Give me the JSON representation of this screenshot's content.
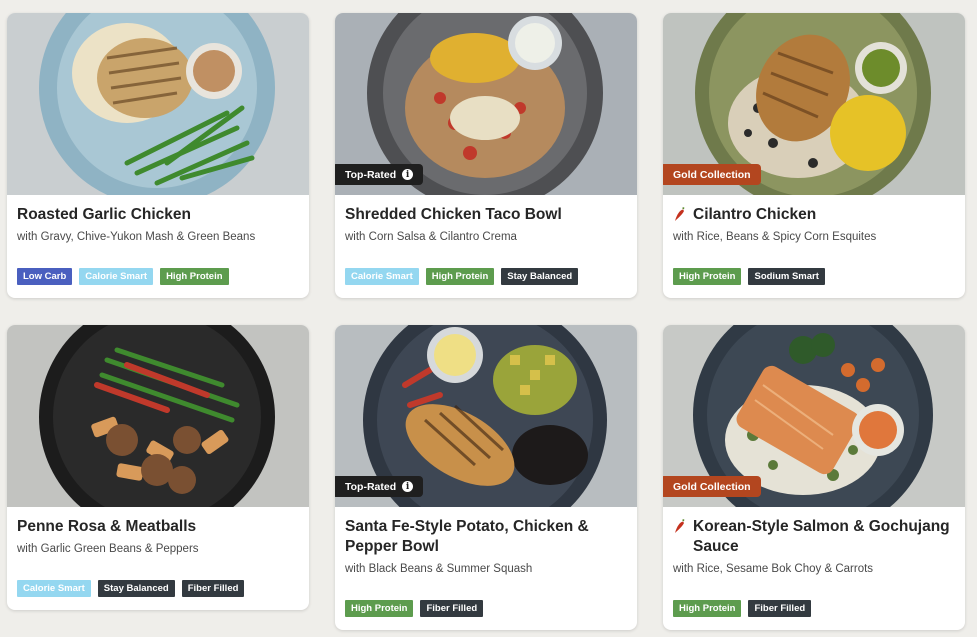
{
  "meals": [
    {
      "title": "Roasted Garlic Chicken",
      "subtitle": "with Gravy, Chive-Yukon Mash & Green Beans",
      "ribbon": null,
      "spicy": false,
      "tags": [
        "Low Carb",
        "Calorie Smart",
        "High Protein"
      ]
    },
    {
      "title": "Shredded Chicken Taco Bowl",
      "subtitle": "with Corn Salsa & Cilantro Crema",
      "ribbon": "Top-Rated",
      "spicy": false,
      "tags": [
        "Calorie Smart",
        "High Protein",
        "Stay Balanced"
      ]
    },
    {
      "title": "Cilantro Chicken",
      "subtitle": "with Rice, Beans & Spicy Corn Esquites",
      "ribbon": "Gold Collection",
      "spicy": true,
      "tags": [
        "High Protein",
        "Sodium Smart"
      ]
    },
    {
      "title": "Penne Rosa & Meatballs",
      "subtitle": "with Garlic Green Beans & Peppers",
      "ribbon": null,
      "spicy": false,
      "tags": [
        "Calorie Smart",
        "Stay Balanced",
        "Fiber Filled"
      ]
    },
    {
      "title": "Santa Fe-Style Potato, Chicken & Pepper Bowl",
      "subtitle": "with Black Beans & Summer Squash",
      "ribbon": "Top-Rated",
      "spicy": false,
      "tags": [
        "High Protein",
        "Fiber Filled"
      ]
    },
    {
      "title": "Korean-Style Salmon & Gochujang Sauce",
      "subtitle": "with Rice, Sesame Bok Choy & Carrots",
      "ribbon": "Gold Collection",
      "spicy": true,
      "tags": [
        "High Protein",
        "Fiber Filled"
      ]
    }
  ],
  "colors": {
    "low_carb": "#4a5fbf",
    "calorie_smart": "#94d7f0",
    "high_protein": "#5d9c4e",
    "dark_tag": "#333a40",
    "top_rated": "#1f1f1f",
    "gold_collection": "#b3461f"
  },
  "icons": {
    "info": "info-icon",
    "spicy": "chili-pepper-icon"
  }
}
